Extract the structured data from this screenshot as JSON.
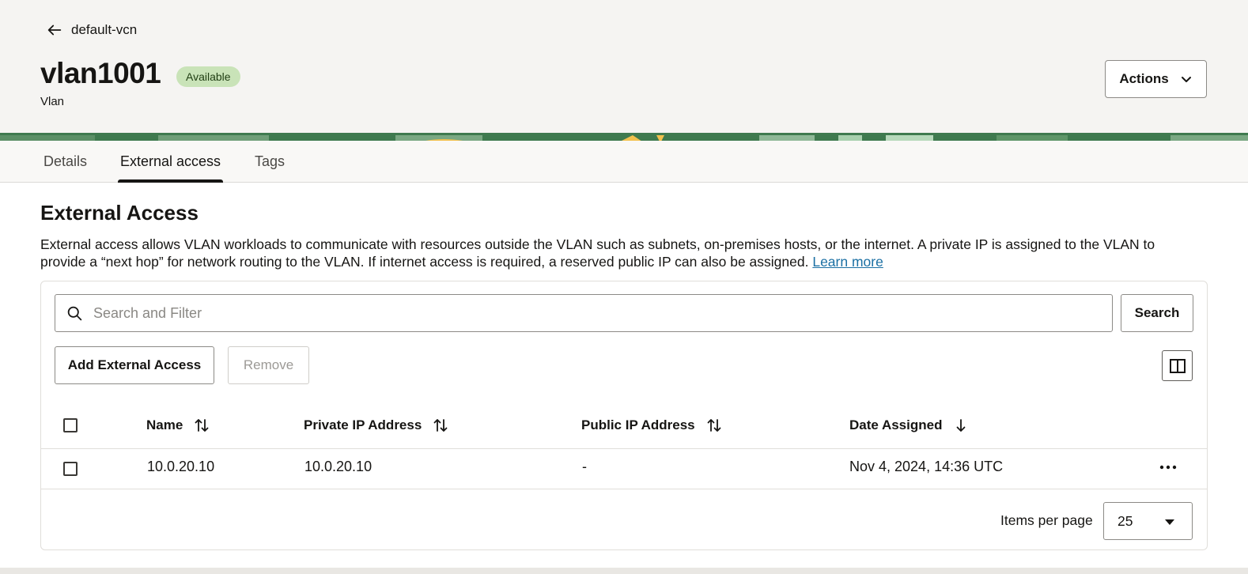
{
  "header": {
    "back_label": "default-vcn",
    "title": "vlan1001",
    "status_badge": "Available",
    "subtitle": "Vlan",
    "actions_label": "Actions"
  },
  "tabs": [
    {
      "label": "Details",
      "active": false
    },
    {
      "label": "External access",
      "active": true
    },
    {
      "label": "Tags",
      "active": false
    }
  ],
  "section": {
    "title": "External Access",
    "description": "External access allows VLAN workloads to communicate with resources outside the VLAN such as subnets, on-premises hosts, or the internet. A private IP is assigned to the VLAN to provide a “next hop” for network routing to the VLAN. If internet access is required, a reserved public IP can also be assigned.",
    "learn_more": "Learn more"
  },
  "toolbar": {
    "search_placeholder": "Search and Filter",
    "search_value": "",
    "search_button": "Search",
    "add_button": "Add External Access",
    "remove_button": "Remove"
  },
  "table": {
    "columns": [
      "Name",
      "Private IP Address",
      "Public IP Address",
      "Date Assigned"
    ],
    "rows": [
      {
        "name": "10.0.20.10",
        "private_ip": "10.0.20.10",
        "public_ip": "-",
        "date_assigned": "Nov 4, 2024, 14:36 UTC"
      }
    ]
  },
  "pagination": {
    "label": "Items per page",
    "value": "25"
  },
  "colors": {
    "badge_bg": "#c9e3b8",
    "link": "#1a6fa3",
    "header_bg": "#f5f4f2",
    "banner": "#3f7a4f"
  },
  "icons": [
    "arrow-left-icon",
    "chevron-down-icon",
    "search-icon",
    "columns-icon",
    "sort-icon",
    "sort-desc-icon",
    "more-actions-icon",
    "caret-down-icon"
  ]
}
